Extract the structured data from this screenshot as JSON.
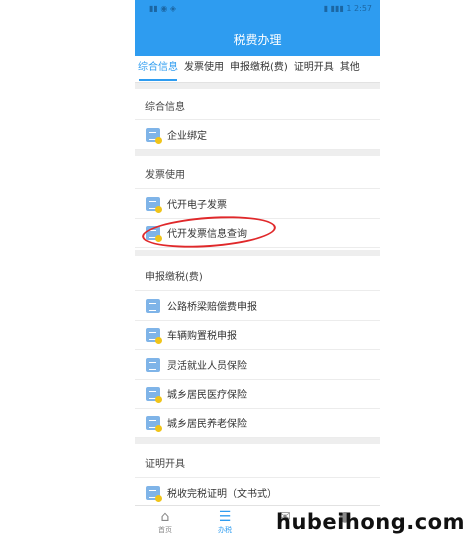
{
  "status_bar": {
    "left": "▮▮ ◉ ◈",
    "right": "▮ ▮▮▮ 1 2:57"
  },
  "header": {
    "title": "税费办理"
  },
  "tabs": [
    {
      "label": "综合信息",
      "active": true
    },
    {
      "label": "发票使用",
      "active": false
    },
    {
      "label": "申报缴税(费)",
      "active": false
    },
    {
      "label": "证明开具",
      "active": false
    },
    {
      "label": "其他",
      "active": false
    }
  ],
  "sections": [
    {
      "title": "综合信息",
      "items": [
        {
          "label": "企业绑定",
          "icon": "document-icon"
        }
      ]
    },
    {
      "title": "发票使用",
      "items": [
        {
          "label": "代开电子发票",
          "icon": "document-icon"
        },
        {
          "label": "代开发票信息查询",
          "icon": "document-icon",
          "highlighted": true
        }
      ]
    },
    {
      "title": "申报缴税(费)",
      "items": [
        {
          "label": "公路桥梁赔偿费申报",
          "icon": "yuan-icon"
        },
        {
          "label": "车辆购置税申报",
          "icon": "document-icon"
        },
        {
          "label": "灵活就业人员保险",
          "icon": "yuan-icon"
        },
        {
          "label": "城乡居民医疗保险",
          "icon": "document-icon"
        },
        {
          "label": "城乡居民养老保险",
          "icon": "document-icon"
        }
      ]
    },
    {
      "title": "证明开具",
      "items": [
        {
          "label": "税收完税证明（文书式）",
          "icon": "document-icon"
        }
      ]
    }
  ],
  "bottom_nav": [
    {
      "label": "首页",
      "icon": "home-icon",
      "active": false
    },
    {
      "label": "办税",
      "icon": "tax-list-icon",
      "active": true
    },
    {
      "label": "",
      "icon": "message-icon",
      "active": false
    },
    {
      "label": "",
      "icon": "user-icon",
      "active": false
    }
  ],
  "watermark": "hubeihong.com",
  "colors": {
    "accent": "#2e9cf0",
    "highlight_oval": "#e0282a"
  }
}
